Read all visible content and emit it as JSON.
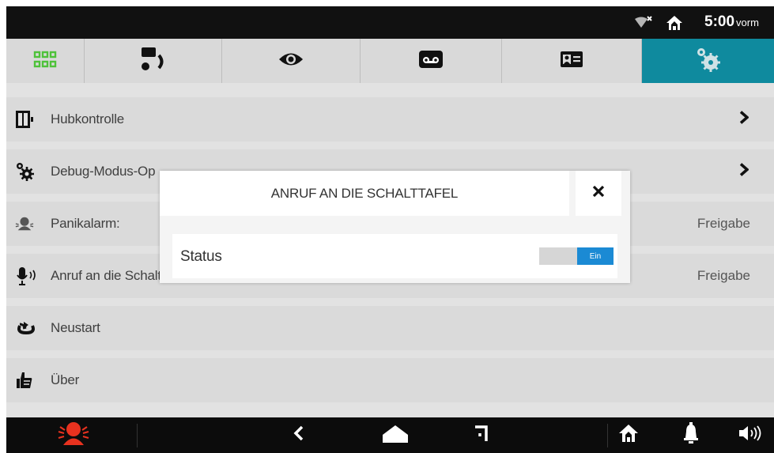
{
  "status_bar": {
    "time": "5:00",
    "time_suffix": "vorm"
  },
  "tabs": [
    {
      "icon": "app-grid-icon"
    },
    {
      "icon": "intercom-call-icon"
    },
    {
      "icon": "eye-icon"
    },
    {
      "icon": "voicemail-icon"
    },
    {
      "icon": "contact-card-icon"
    },
    {
      "icon": "settings-gears-icon",
      "active": true
    }
  ],
  "settings": [
    {
      "label": "Hubkontrolle",
      "value": "",
      "icon": "elevator-icon"
    },
    {
      "label": "Debug-Modus-Op",
      "value": "",
      "icon": "gears-icon"
    },
    {
      "label": "Panikalarm:",
      "value": "Freigabe",
      "icon": "panic-alarm-icon"
    },
    {
      "label": "Anruf an die Schaltafel:",
      "value": "Freigabe",
      "icon": "microphone-icon"
    },
    {
      "label": "Neustart",
      "value": "",
      "icon": "restart-icon"
    },
    {
      "label": "Über",
      "value": "",
      "icon": "thumbs-up-icon"
    }
  ],
  "dialog": {
    "title": "ANRUF AN DIE SCHALTTAFEL",
    "status_label": "Status",
    "toggle_on_label": "Ein"
  },
  "colors": {
    "accent_tab": "#0f8a9e",
    "toggle_on": "#1b8ad4",
    "panic_red": "#e8321f",
    "apps_green": "#4ec23a"
  }
}
